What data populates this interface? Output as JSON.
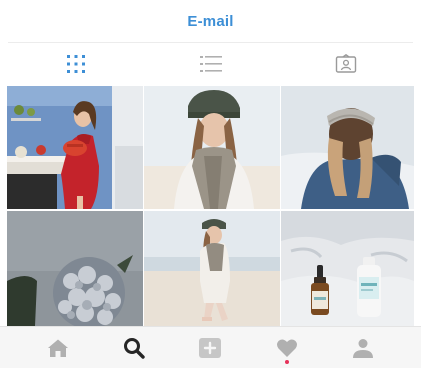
{
  "header": {
    "title": "E-mail"
  },
  "view_tabs": {
    "items": [
      {
        "icon": "grid-view-icon",
        "active": true
      },
      {
        "icon": "list-view-icon",
        "active": false
      },
      {
        "icon": "tagged-photos-icon",
        "active": false
      }
    ]
  },
  "posts": [
    {
      "subject": "woman-red-sweater-kitchen"
    },
    {
      "subject": "woman-beanie-scarf-beach"
    },
    {
      "subject": "woman-headband-back-view"
    },
    {
      "subject": "gray-hydrangea-flowers"
    },
    {
      "subject": "woman-walking-beach"
    },
    {
      "subject": "skincare-bottles-sand"
    }
  ],
  "bottom_nav": {
    "items": [
      {
        "icon": "home-icon"
      },
      {
        "icon": "search-icon",
        "active": true
      },
      {
        "icon": "add-post-icon"
      },
      {
        "icon": "activity-heart-icon",
        "has_notification": true
      },
      {
        "icon": "profile-icon"
      }
    ]
  },
  "colors": {
    "accent": "#3d8fd6",
    "icon_gray": "#b0b0b0",
    "icon_active": "#262626",
    "notification": "#e6325a",
    "nav_background": "#f6f6f6"
  }
}
